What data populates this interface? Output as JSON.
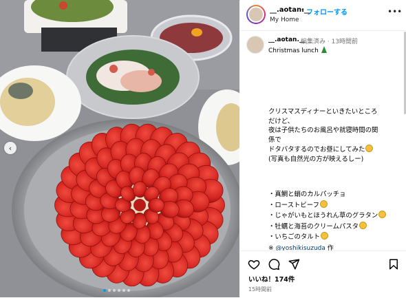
{
  "post": {
    "username": "__.aotan.__",
    "separator": "•",
    "follow_label": "フォローする",
    "subtitle": "My Home",
    "more_label": "•••"
  },
  "caption": {
    "username": "__.aotan.__",
    "meta": "編集済み · 13時間前",
    "title": "Christmas lunch",
    "lines": [
      "クリスマスディナーといきたいところ",
      "だけど、",
      "夜は子供たちのお風呂や就寝時間の関",
      "係で",
      "ドタバタするのでお昼にしてみた",
      "(写真も自然光の方が映えるしー)"
    ],
    "list": [
      "・真鯛と蛸のカルパッチョ",
      "・ローストビーフ",
      "・じゃがいもとほうれん草のグラタン",
      "・牡蠣と海苔のクリームパスタ",
      "・いちごのタルト"
    ],
    "note_prefix": "※",
    "note_mention": "@yoshikisuzuda",
    "note_suffix": "作"
  },
  "actions": {
    "likes": "いいね！174件",
    "time": "15時間前"
  },
  "carousel": {
    "dot_count": 6,
    "active_index": 0,
    "prev_label": "‹"
  },
  "colors": {
    "accent": "#0095f6",
    "mention": "#00376b",
    "meta": "#737373"
  }
}
